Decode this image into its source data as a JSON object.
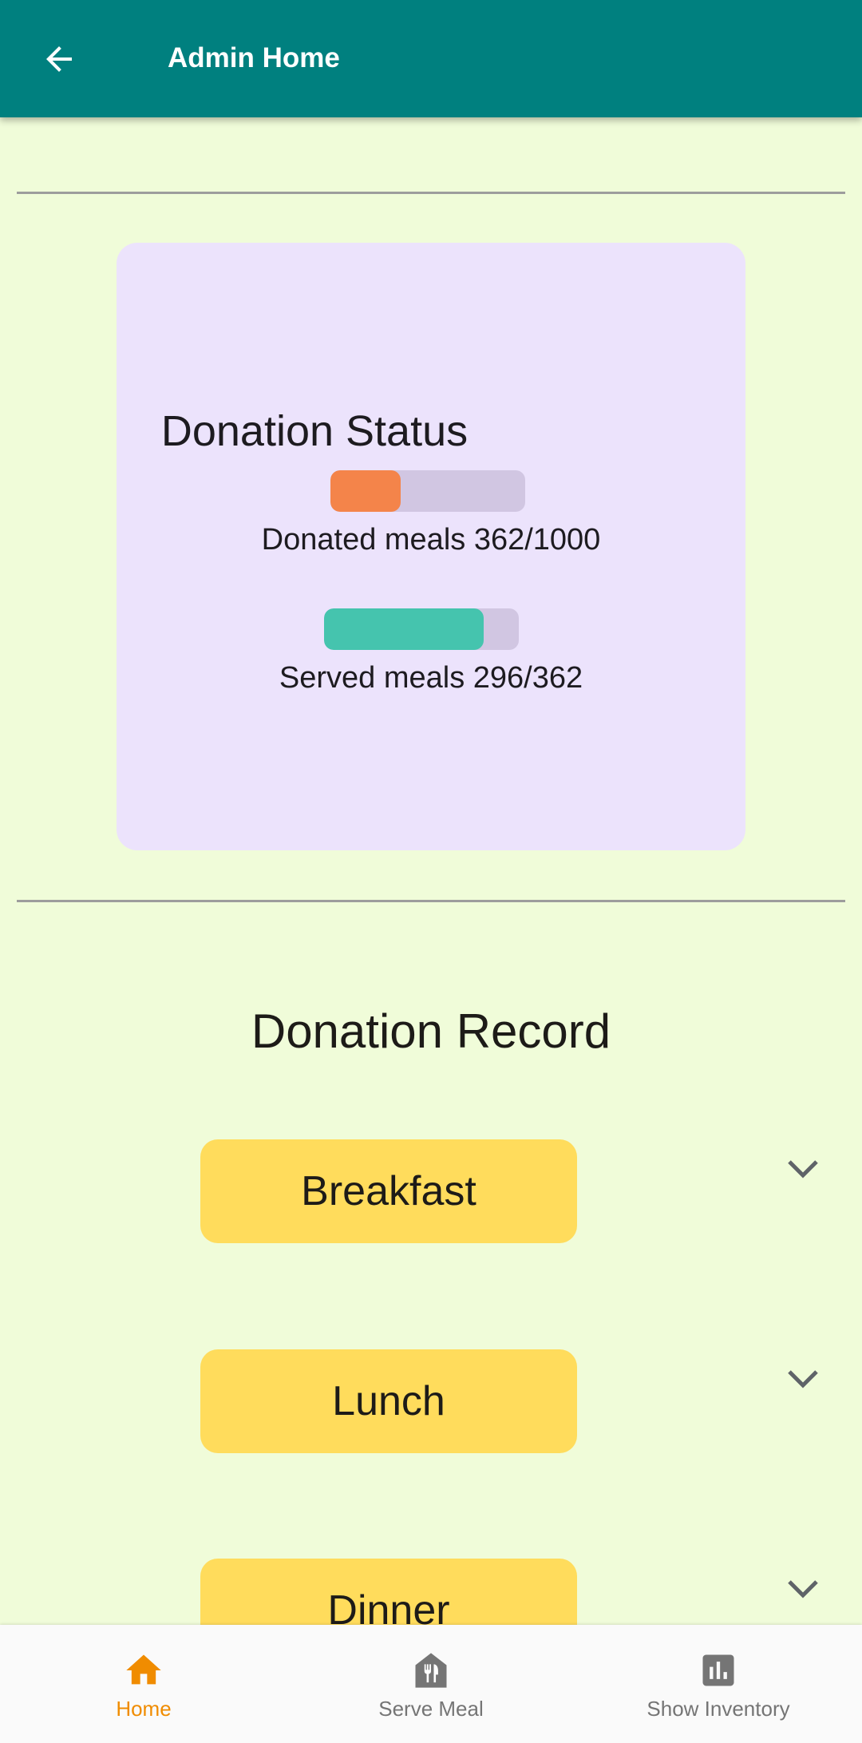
{
  "app_bar": {
    "title": "Admin Home"
  },
  "donation_status": {
    "title": "Donation Status",
    "donated": {
      "text": "Donated meals 362/1000",
      "progress": 0.362,
      "color": "#f4844a"
    },
    "served": {
      "text": "Served meals 296/362",
      "progress": 0.818,
      "color": "#45c4ae"
    }
  },
  "donation_record": {
    "title": "Donation Record",
    "meals": [
      "Breakfast",
      "Lunch",
      "Dinner"
    ]
  },
  "bottom_nav": {
    "items": [
      {
        "label": "Home",
        "icon": "home-icon",
        "active": true
      },
      {
        "label": "Serve Meal",
        "icon": "restaurant-icon",
        "active": false
      },
      {
        "label": "Show Inventory",
        "icon": "bar-chart-icon",
        "active": false
      }
    ],
    "active_color": "#f08c00",
    "inactive_color": "#757575"
  }
}
